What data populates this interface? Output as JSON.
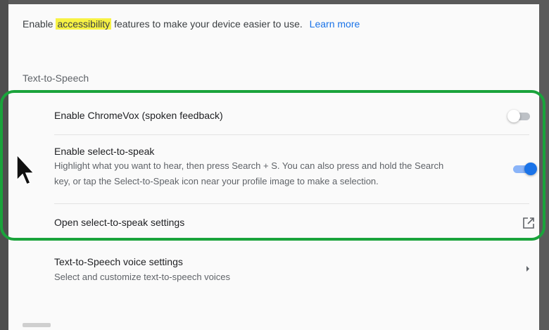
{
  "intro": {
    "before": "Enable ",
    "highlight": "accessibility",
    "after": " features to make your device easier to use.",
    "link": "Learn more"
  },
  "section": {
    "title": "Text-to-Speech"
  },
  "settings": {
    "chromevox": {
      "label": "Enable ChromeVox (spoken feedback)",
      "enabled": false
    },
    "select_to_speak": {
      "label": "Enable select-to-speak",
      "description_line1": "Highlight what you want to hear, then press Search + S. You can also press and hold the Search",
      "description_line2": "key, or tap the Select-to-Speak icon near your profile image to make a selection.",
      "enabled": true
    },
    "open_settings": {
      "label": "Open select-to-speak settings",
      "icon": "external-link-icon"
    },
    "voice_settings": {
      "label": "Text-to-Speech voice settings",
      "description": "Select and customize text-to-speech voices",
      "icon": "chevron-right-icon"
    }
  },
  "colors": {
    "highlight": "#f7f244",
    "link": "#1a73e8",
    "annotation_box": "#1aa33b",
    "toggle_on": "#1a73e8"
  }
}
